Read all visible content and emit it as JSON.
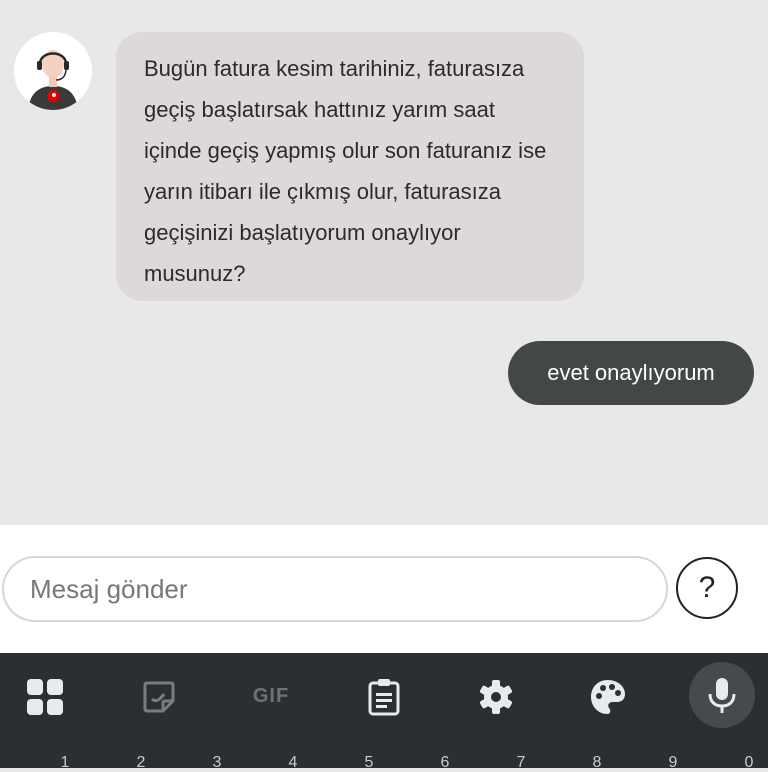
{
  "chat": {
    "incoming_message": "Bugün fatura kesim tarihiniz, faturasıza geçiş başlatırsak hattınız yarım saat içinde geçiş yapmış olur son faturanız ise yarın itibarı ile çıkmış olur, faturasıza geçişinizi başlatıyorum onaylıyor musunuz?",
    "outgoing_message": "evet onaylıyorum"
  },
  "composer": {
    "placeholder": "Mesaj gönder",
    "value": "",
    "help_label": "?"
  },
  "keyboard": {
    "toolbar": [
      {
        "name": "apps-grid-icon"
      },
      {
        "name": "sticker-icon"
      },
      {
        "name": "gif-button",
        "label": "GIF"
      },
      {
        "name": "clipboard-icon"
      },
      {
        "name": "settings-gear-icon"
      },
      {
        "name": "palette-icon"
      },
      {
        "name": "microphone-icon"
      }
    ],
    "number_row": [
      "1",
      "2",
      "3",
      "4",
      "5",
      "6",
      "7",
      "8",
      "9",
      "0"
    ]
  },
  "colors": {
    "incoming_bubble": "#ddd9da",
    "outgoing_bubble": "#444748",
    "keyboard_bg": "#2b2f31",
    "brand_red": "#e60000"
  }
}
